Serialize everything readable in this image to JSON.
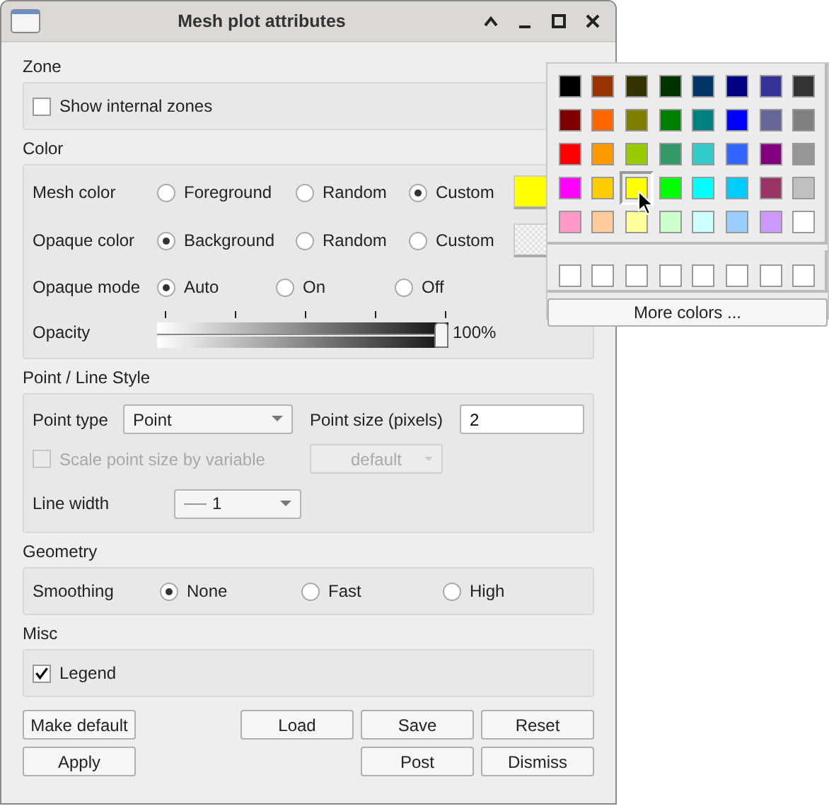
{
  "window": {
    "title": "Mesh plot attributes"
  },
  "zone": {
    "label": "Zone",
    "show_internal_zones": {
      "label": "Show internal zones",
      "checked": false
    }
  },
  "color": {
    "label": "Color",
    "rows": [
      {
        "kind": "radio",
        "label": "Mesh color",
        "options": [
          {
            "label": "Foreground",
            "selected": false
          },
          {
            "label": "Random",
            "selected": false
          },
          {
            "label": "Custom",
            "selected": true
          }
        ],
        "swatch": {
          "kind": "solid",
          "color": "#ffff00"
        }
      },
      {
        "kind": "radio",
        "label": "Opaque color",
        "options": [
          {
            "label": "Background",
            "selected": true
          },
          {
            "label": "Random",
            "selected": false
          },
          {
            "label": "Custom",
            "selected": false
          }
        ],
        "swatch": {
          "kind": "pattern"
        }
      },
      {
        "kind": "radio",
        "label": "Opaque mode",
        "options": [
          {
            "label": "Auto",
            "selected": true
          },
          {
            "label": "On",
            "selected": false
          },
          {
            "label": "Off",
            "selected": false
          }
        ]
      },
      {
        "kind": "slider",
        "label": "Opacity",
        "level": 1,
        "reading": "100%"
      }
    ]
  },
  "point_line": {
    "label": "Point / Line Style",
    "point_type": {
      "label": "Point type",
      "value": "Point"
    },
    "point_size": {
      "label": "Point size (pixels)",
      "value": "2"
    },
    "scale_by_variable": {
      "label": "Scale point size by variable",
      "checked": false,
      "disabled": true
    },
    "scale_variable": {
      "value": "default",
      "disabled": true
    },
    "line_width": {
      "label": "Line width",
      "value": "1"
    }
  },
  "geometry": {
    "label": "Geometry",
    "smoothing": {
      "label": "Smoothing",
      "options": [
        {
          "label": "None",
          "selected": true
        },
        {
          "label": "Fast",
          "selected": false
        },
        {
          "label": "High",
          "selected": false
        }
      ]
    }
  },
  "misc": {
    "label": "Misc",
    "legend": {
      "label": "Legend",
      "checked": true
    }
  },
  "buttons": [
    {
      "left": "Make default",
      "right": [
        "Load",
        "Save",
        "Reset"
      ]
    },
    {
      "left": "Apply",
      "right": [
        "Post",
        "Dismiss"
      ]
    }
  ],
  "color_popup": {
    "palette": [
      [
        {
          "color": "#000000",
          "selected": false
        },
        {
          "color": "#993300",
          "selected": false
        },
        {
          "color": "#333300",
          "selected": false
        },
        {
          "color": "#003300",
          "selected": false
        },
        {
          "color": "#003366",
          "selected": false
        },
        {
          "color": "#000080",
          "selected": false
        },
        {
          "color": "#333399",
          "selected": false
        },
        {
          "color": "#333333",
          "selected": false
        }
      ],
      [
        {
          "color": "#800000",
          "selected": false
        },
        {
          "color": "#ff6600",
          "selected": false
        },
        {
          "color": "#808000",
          "selected": false
        },
        {
          "color": "#008000",
          "selected": false
        },
        {
          "color": "#008080",
          "selected": false
        },
        {
          "color": "#0000ff",
          "selected": false
        },
        {
          "color": "#666699",
          "selected": false
        },
        {
          "color": "#808080",
          "selected": false
        }
      ],
      [
        {
          "color": "#ff0000",
          "selected": false
        },
        {
          "color": "#ff9900",
          "selected": false
        },
        {
          "color": "#99cc00",
          "selected": false
        },
        {
          "color": "#339966",
          "selected": false
        },
        {
          "color": "#33cccc",
          "selected": false
        },
        {
          "color": "#3366ff",
          "selected": false
        },
        {
          "color": "#800080",
          "selected": false
        },
        {
          "color": "#969696",
          "selected": false
        }
      ],
      [
        {
          "color": "#ff00ff",
          "selected": false
        },
        {
          "color": "#ffcc00",
          "selected": false
        },
        {
          "color": "#ffff00",
          "selected": true
        },
        {
          "color": "#00ff00",
          "selected": false
        },
        {
          "color": "#00ffff",
          "selected": false
        },
        {
          "color": "#00ccff",
          "selected": false
        },
        {
          "color": "#993366",
          "selected": false
        },
        {
          "color": "#c0c0c0",
          "selected": false
        }
      ],
      [
        {
          "color": "#ff99cc",
          "selected": false
        },
        {
          "color": "#ffcc99",
          "selected": false
        },
        {
          "color": "#ffff99",
          "selected": false
        },
        {
          "color": "#ccffcc",
          "selected": false
        },
        {
          "color": "#ccffff",
          "selected": false
        },
        {
          "color": "#99ccff",
          "selected": false
        },
        {
          "color": "#cc99ff",
          "selected": false
        },
        {
          "color": "#ffffff",
          "selected": false
        }
      ]
    ],
    "custom_colors": [
      {
        "color": "#ffffff"
      },
      {
        "color": "#ffffff"
      },
      {
        "color": "#ffffff"
      },
      {
        "color": "#ffffff"
      },
      {
        "color": "#ffffff"
      },
      {
        "color": "#ffffff"
      },
      {
        "color": "#ffffff"
      },
      {
        "color": "#ffffff"
      }
    ],
    "more_button": "More colors ..."
  }
}
